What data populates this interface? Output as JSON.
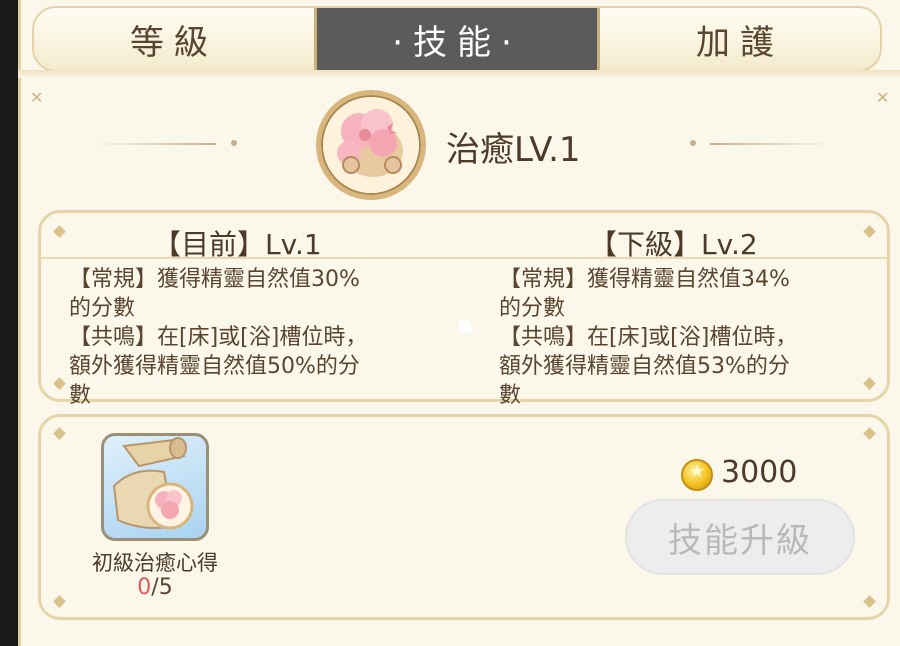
{
  "tabs": [
    {
      "label": "等級"
    },
    {
      "label": "·技能·"
    },
    {
      "label": "加護"
    }
  ],
  "active_tab": 1,
  "skill": {
    "title": "治癒LV.1",
    "icon": "healing-skill-icon"
  },
  "current": {
    "header": "【目前】Lv.1",
    "line1": "【常規】獲得精靈自然值30%",
    "line2": "的分數",
    "line3": "【共鳴】在[床]或[浴]槽位時，",
    "line4": "額外獲得精靈自然值50%的分",
    "line5": "數"
  },
  "next": {
    "header": "【下級】Lv.2",
    "line1": "【常規】獲得精靈自然值34%",
    "line2": "的分數",
    "line3": "【共鳴】在[床]或[浴]槽位時，",
    "line4": "額外獲得精靈自然值53%的分",
    "line5": "數"
  },
  "material": {
    "name": "初級治癒心得",
    "have": "0",
    "sep": "/",
    "need": "5",
    "icon": "scroll-item-icon"
  },
  "cost": {
    "amount": "3000",
    "icon": "gold-coin-icon"
  },
  "upgrade_button": "技能升級",
  "colors": {
    "active_tab_bg": "#5b5b5b",
    "panel_bg": "#fbf7ea",
    "border": "#e6d5a8",
    "text": "#4d3a28",
    "count_have": "#e05a5a",
    "button_disabled": "#ededed"
  }
}
